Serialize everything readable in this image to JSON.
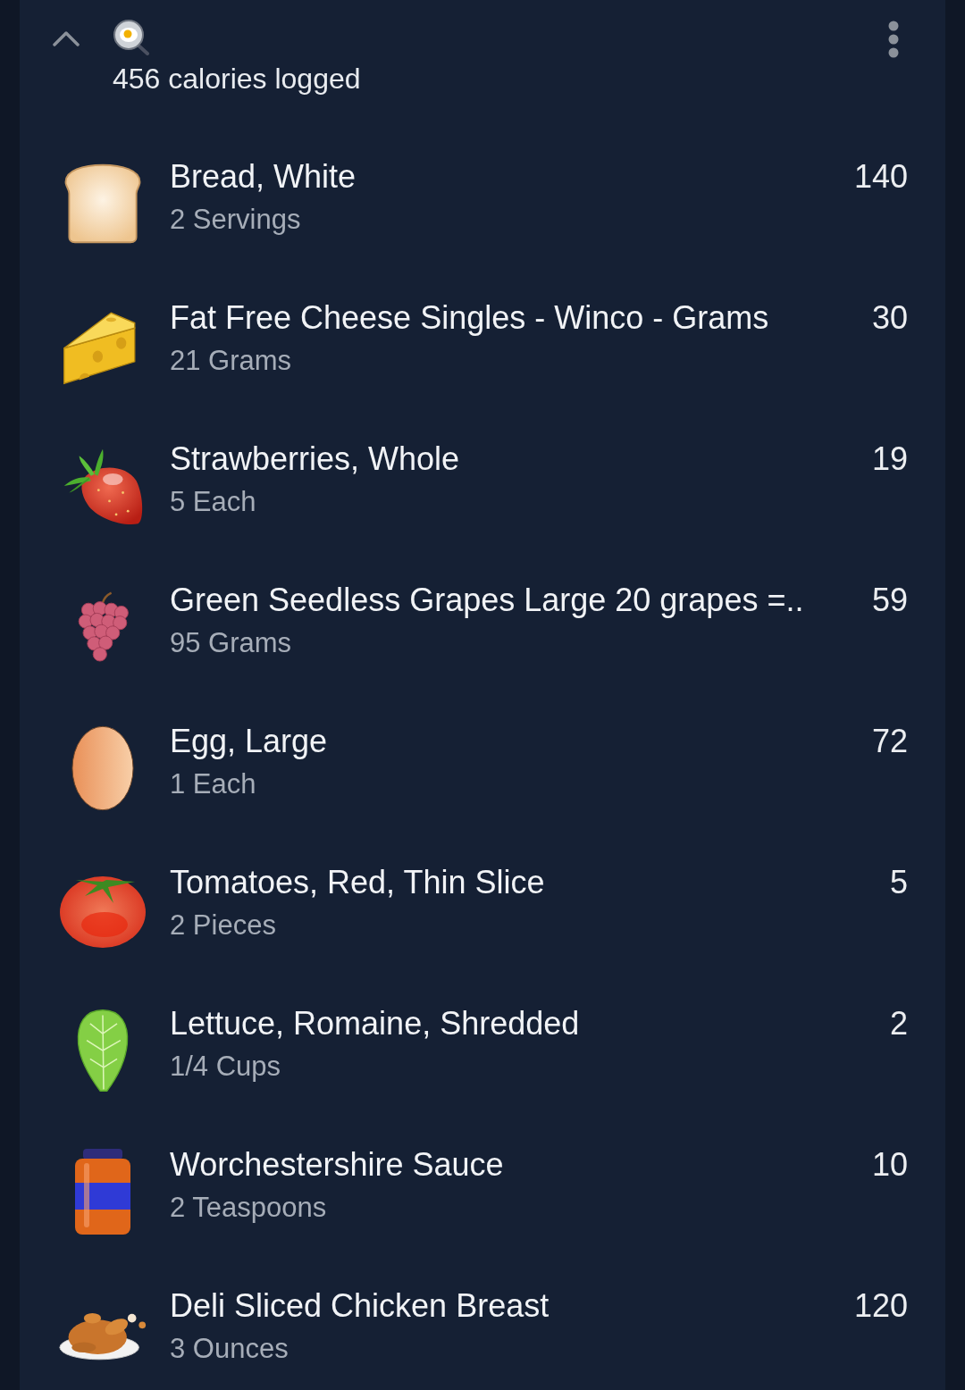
{
  "header": {
    "summary": "456 calories logged"
  },
  "entries": [
    {
      "name": "Bread, White",
      "amount": "2 Servings",
      "calories": "140"
    },
    {
      "name": "Fat Free Cheese Singles - Winco - Grams",
      "amount": "21 Grams",
      "calories": "30"
    },
    {
      "name": "Strawberries, Whole",
      "amount": "5 Each",
      "calories": "19"
    },
    {
      "name": "Green Seedless Grapes Large 20 grapes =..",
      "amount": "95 Grams",
      "calories": "59"
    },
    {
      "name": "Egg, Large",
      "amount": "1 Each",
      "calories": "72"
    },
    {
      "name": "Tomatoes, Red, Thin Slice",
      "amount": "2 Pieces",
      "calories": "5"
    },
    {
      "name": "Lettuce, Romaine, Shredded",
      "amount": "1/4 Cups",
      "calories": "2"
    },
    {
      "name": "Worchestershire Sauce",
      "amount": "2 Teaspoons",
      "calories": "10"
    },
    {
      "name": "Deli Sliced Chicken Breast",
      "amount": "3 Ounces",
      "calories": "120"
    }
  ]
}
